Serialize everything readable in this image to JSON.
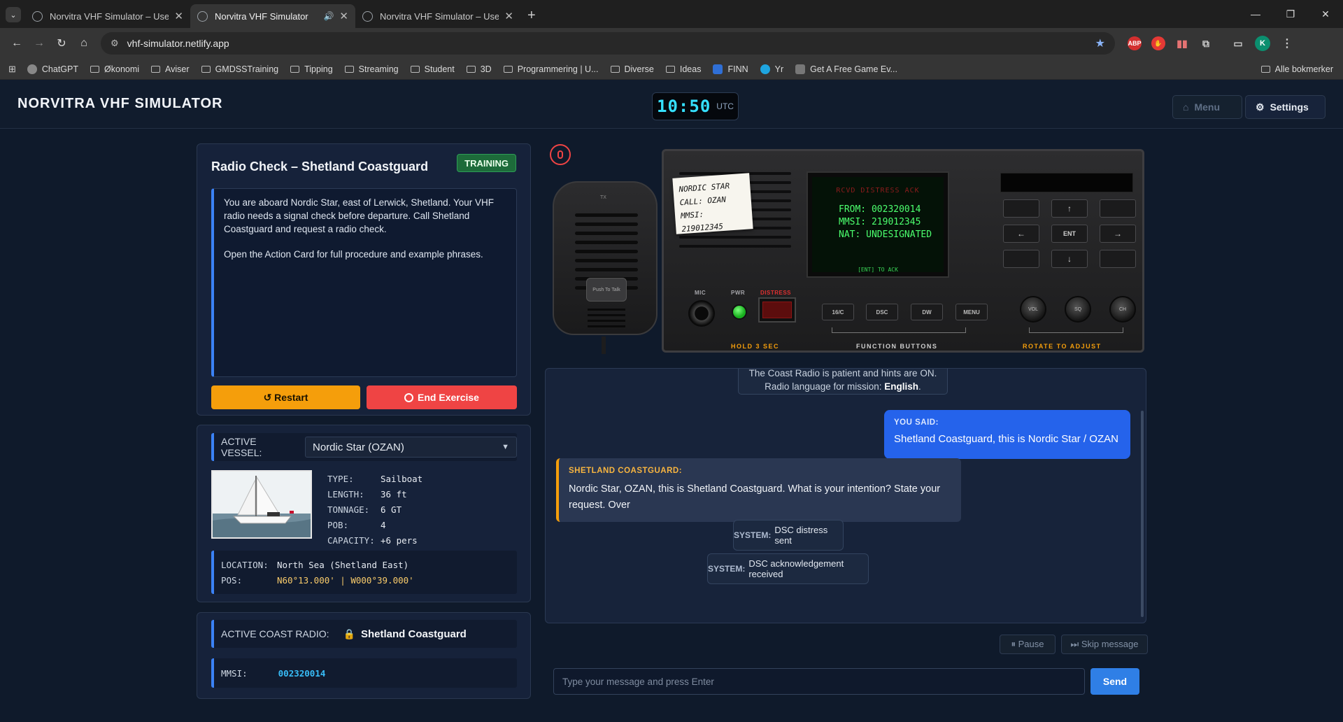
{
  "browser": {
    "tabs": [
      {
        "title": "Norvitra VHF Simulator – User G",
        "active": false
      },
      {
        "title": "Norvitra VHF Simulator",
        "active": true
      },
      {
        "title": "Norvitra VHF Simulator – User G",
        "active": false
      }
    ],
    "url": "vhf-simulator.netlify.app",
    "bookmarks": [
      "ChatGPT",
      "Økonomi",
      "Aviser",
      "GMDSSTraining",
      "Tipping",
      "Streaming",
      "Student",
      "3D",
      "Programmering | U...",
      "Diverse",
      "Ideas",
      "FINN",
      "Yr",
      "Get A Free Game Ev..."
    ],
    "all_bookmarks": "Alle bokmerker",
    "profile_initial": "K"
  },
  "header": {
    "title": "NORVITRA VHF SIMULATOR",
    "clock_time": "10:50",
    "clock_zone": "UTC",
    "menu_label": "Menu",
    "settings_label": "Settings"
  },
  "mission": {
    "title": "Radio Check – Shetland Coastguard",
    "badge": "TRAINING",
    "briefing_p1": "You are aboard Nordic Star, east of Lerwick, Shetland. Your VHF radio needs a signal check before departure. Call Shetland Coastguard and request a radio check.",
    "briefing_p2": "Open the Action Card for full procedure and example phrases.",
    "restart_label": "↺ Restart",
    "end_label": "End Exercise"
  },
  "vessel": {
    "active_label": "ACTIVE VESSEL:",
    "selected": "Nordic Star (OZAN)",
    "specs": [
      {
        "k": "TYPE:",
        "v": "Sailboat"
      },
      {
        "k": "LENGTH:",
        "v": "36 ft"
      },
      {
        "k": "TONNAGE:",
        "v": "6 GT"
      },
      {
        "k": "POB:",
        "v": "4"
      },
      {
        "k": "CAPACITY:",
        "v": "+6 pers"
      }
    ],
    "location_label": "LOCATION:",
    "location": "North Sea (Shetland East)",
    "pos_label": "POS:",
    "pos": "N60°13.000' | W000°39.000'"
  },
  "coast": {
    "label": "ACTIVE COAST RADIO:",
    "name": "Shetland Coastguard",
    "mmsi_label": "MMSI:",
    "mmsi": "002320014"
  },
  "radio": {
    "note_lines": [
      "NORDIC STAR",
      "CALL: OZAN",
      "MMSI: 219012345"
    ],
    "screen_header": "RCVD DISTRESS ACK",
    "screen_lines": [
      "FROM: 002320014",
      "MMSI: 219012345",
      "NAT: UNDESIGNATED"
    ],
    "screen_footer": "[ENT] TO ACK",
    "keys": [
      "",
      "↑",
      "",
      "←",
      "ENT",
      "→",
      "",
      "↓",
      ""
    ],
    "mic_label": "MIC",
    "pwr_label": "PWR",
    "distress_label": "DISTRESS",
    "function_buttons": [
      "16/C",
      "DSC",
      "DW",
      "MENU"
    ],
    "knobs": [
      "VOL",
      "SQ",
      "CH"
    ],
    "hold_caption": "HOLD 3 SEC",
    "function_caption": "FUNCTION BUTTONS",
    "rotate_caption": "ROTATE TO ADJUST",
    "ptt_label": "Push To Talk",
    "handmic_badge": "TX"
  },
  "chat": {
    "system_top_line1": "The Coast Radio is patient and hints are ON.",
    "system_top_line2_prefix": "Radio language for mission: ",
    "system_top_language": "English",
    "you_label": "YOU SAID:",
    "you_text": "Shetland Coastguard, this is Nordic Star / OZAN",
    "cg_label": "SHETLAND COASTGUARD:",
    "cg_text": "Nordic Star, OZAN, this is Shetland Coastguard. What is your intention? State your request. Over",
    "system_label": "SYSTEM:",
    "sys1": "DSC distress sent",
    "sys2": "DSC acknowledgement received",
    "pause_label": "⏸ Pause",
    "skip_label": "⏭ Skip message",
    "input_placeholder": "Type your message and press Enter",
    "send_label": "Send"
  }
}
